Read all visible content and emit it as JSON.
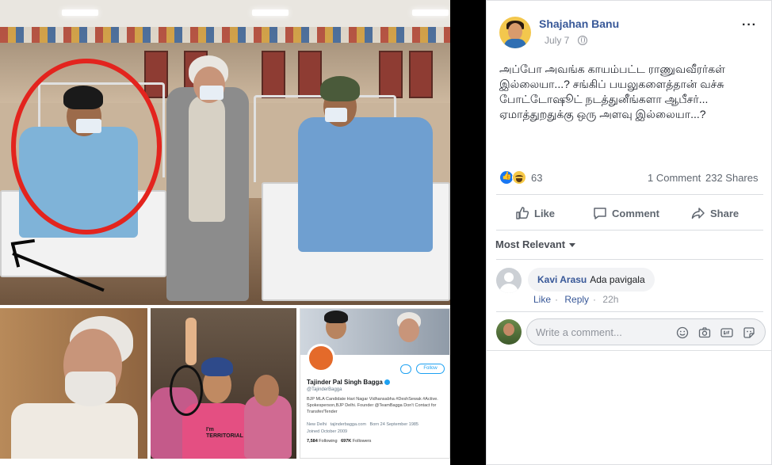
{
  "post": {
    "author": "Shajahan Banu",
    "date": "July 7",
    "more_label": "···",
    "text": "அப்போ அவங்க காயம்பட்ட ராணுவவீரர்கள் இல்லையா...? சங்கிப் பயலுகளைத்தான் வச்சு போட்டோஷூட் நடத்துனீங்களா ஆபீசர்... ஏமாத்துறதுக்கு ஒரு அளவு இல்லையா...?",
    "reaction_count": "63",
    "comment_count": "1 Comment",
    "share_count": "232 Shares"
  },
  "actions": {
    "like": "Like",
    "comment": "Comment",
    "share": "Share"
  },
  "comments_section": {
    "sort_label": "Most Relevant",
    "comments": [
      {
        "author": "Kavi Arasu",
        "text": "Ada pavigala",
        "like_label": "Like",
        "reply_label": "Reply",
        "time": "22h"
      }
    ],
    "input_placeholder": "Write a comment..."
  },
  "image": {
    "twitter_card": {
      "name": "Tajinder Pal Singh Bagga",
      "handle": "@TajinderBagga",
      "follow_label": "Follow",
      "bio": "BJP MLA Candidate Hari Nagar Vidhansabha #DeshSewak #Active. Spokesperson,BJP Delhi. Founder @TeamBagga Don't Contact for Transfer/Tender",
      "location": "New Delhi",
      "website": "tajinderbagga.com",
      "birthday": "Born 24 September 1985",
      "joined": "Joined October 2009",
      "following": "7,584",
      "following_label": "Following",
      "followers": "697K",
      "followers_label": "Followers"
    },
    "shirt_text": "I'm TERRITORIAL"
  },
  "colors": {
    "link_blue": "#385898",
    "like_blue": "#1877f2",
    "red_circle": "#e3241e",
    "twitter_blue": "#1da1f2"
  },
  "icons": [
    "more-icon",
    "globe-icon",
    "like-icon",
    "comment-icon",
    "share-icon",
    "caret-down-icon",
    "smile-icon",
    "camera-icon",
    "gif-icon",
    "sticker-icon"
  ]
}
